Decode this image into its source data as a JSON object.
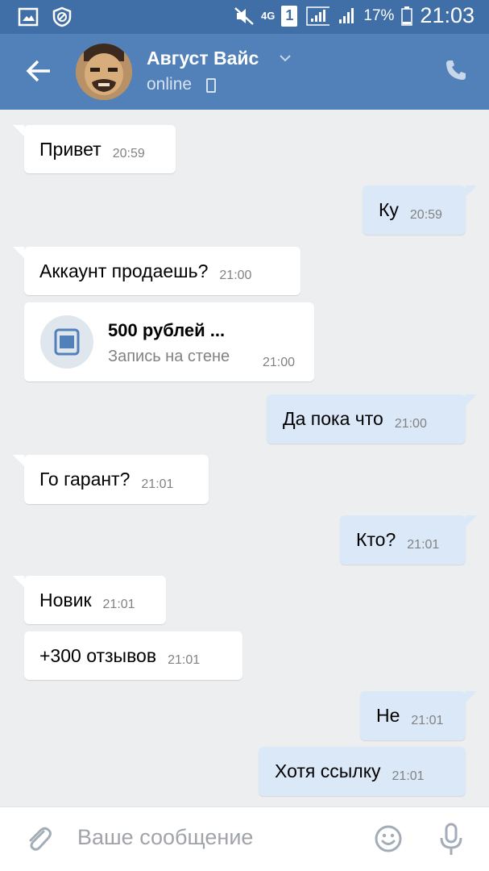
{
  "status_bar": {
    "net": "4G",
    "sim": "1",
    "battery": "17%",
    "time": "21:03"
  },
  "header": {
    "name": "Август Вайс",
    "status": "online"
  },
  "messages": [
    {
      "text": "Привет",
      "time": "20:59"
    },
    {
      "text": "Ку",
      "time": "20:59"
    },
    {
      "text": "Аккаунт продаешь?",
      "time": "21:00"
    },
    {
      "text": "Да пока что",
      "time": "21:00"
    },
    {
      "text": "Го гарант?",
      "time": "21:01"
    },
    {
      "text": "Кто?",
      "time": "21:01"
    },
    {
      "text": "Новик",
      "time": "21:01"
    },
    {
      "text": "+300 отзывов",
      "time": "21:01"
    },
    {
      "text": "Не",
      "time": "21:01"
    },
    {
      "text": "Хотя ссылку",
      "time": "21:01"
    }
  ],
  "wall_post": {
    "title": "500 рублей ...",
    "subtitle": "Запись на стене",
    "time": "21:00"
  },
  "composer": {
    "placeholder": "Ваше сообщение"
  },
  "colors": {
    "header": "#5181b8",
    "statusbar": "#3f6fa6",
    "incoming": "#ffffff",
    "outgoing": "#dbe8f7"
  }
}
